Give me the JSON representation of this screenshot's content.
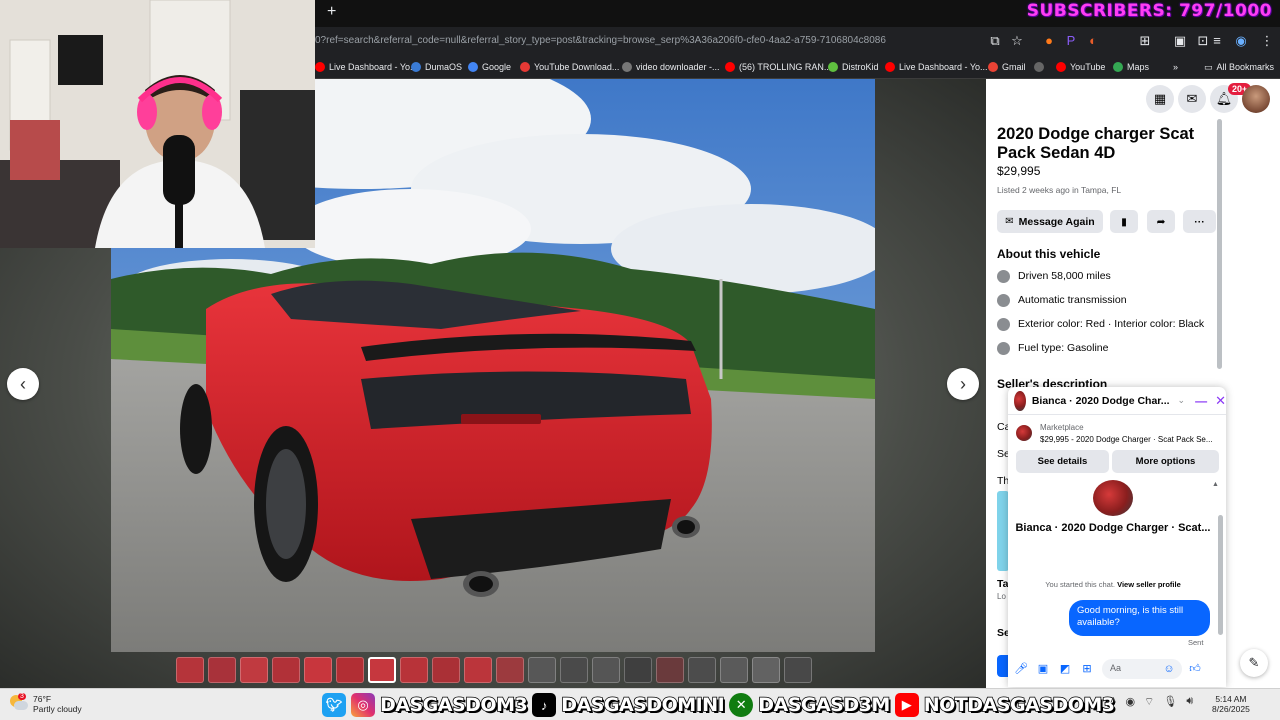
{
  "overlay": {
    "subscribers": "SUBSCRIBERS: 797/1000"
  },
  "browser": {
    "url": "0?ref=search&referral_code=null&referral_story_type=post&tracking=browse_serp%3A36a206f0-cfe0-4aa2-a759-7106804c8086",
    "bookmarks": [
      {
        "label": "Live Dashboard - Yo...",
        "color": "#ff0000"
      },
      {
        "label": "DumaOS",
        "color": "#3a7bd5"
      },
      {
        "label": "Google",
        "color": "#4285f4"
      },
      {
        "label": "YouTube Download...",
        "color": "#e53935"
      },
      {
        "label": "video downloader -...",
        "color": "#777777"
      },
      {
        "label": "(56) TROLLING RAN...",
        "color": "#ff0000"
      },
      {
        "label": "DistroKid",
        "color": "#5fbf3f"
      },
      {
        "label": "Live Dashboard - Yo...",
        "color": "#ff0000"
      },
      {
        "label": "Gmail",
        "color": "#ea4335"
      },
      {
        "label": "",
        "color": "#666666"
      },
      {
        "label": "YouTube",
        "color": "#ff0000"
      },
      {
        "label": "Maps",
        "color": "#34a853"
      }
    ],
    "all_bookmarks": "All Bookmarks"
  },
  "listing": {
    "title": "2020 Dodge charger Scat Pack Sedan 4D",
    "price": "$29,995",
    "listed": "Listed 2 weeks ago in Tampa, FL",
    "message_again": "Message Again",
    "about_heading": "About this vehicle",
    "features": [
      {
        "text": "Driven 58,000 miles",
        "icon": "speedometer-icon"
      },
      {
        "text": "Automatic transmission",
        "icon": "transmission-icon"
      },
      {
        "text": "Exterior color: Red · Interior color: Black",
        "icon": "paint-icon"
      },
      {
        "text": "Fuel type: Gasoline",
        "icon": "fuel-icon"
      }
    ],
    "seller_desc_heading": "Seller's description",
    "cut_text": [
      "Ca",
      "Se",
      "Th",
      "Ta",
      "Lo",
      "Se"
    ]
  },
  "notifications": {
    "badge": "20+"
  },
  "chat": {
    "name": "Bianca · 2020 Dodge Char...",
    "marketplace_label": "Marketplace",
    "marketplace_line": "$29,995 - 2020 Dodge Charger · Scat Pack Se...",
    "see_details": "See details",
    "more_options": "More options",
    "big_name": "Bianca · 2020 Dodge Charger · Scat...",
    "started": "You started this chat.",
    "view_profile": "View seller profile",
    "message": "Good morning, is this still available?",
    "sent": "Sent",
    "input_placeholder": "Aa"
  },
  "taskbar": {
    "weather_temp": "76°F",
    "weather_desc": "Partly cloudy",
    "weather_badge": "3",
    "handles": [
      "DASGASDOM3",
      "DASGASDOMINI",
      "DASGASD3M",
      "NOTDASGASDOM3"
    ],
    "time": "5:14 AM",
    "date": "8/26/2025"
  },
  "colors": {
    "fb_blue": "#0866ff",
    "car_red": "#d71f26"
  }
}
